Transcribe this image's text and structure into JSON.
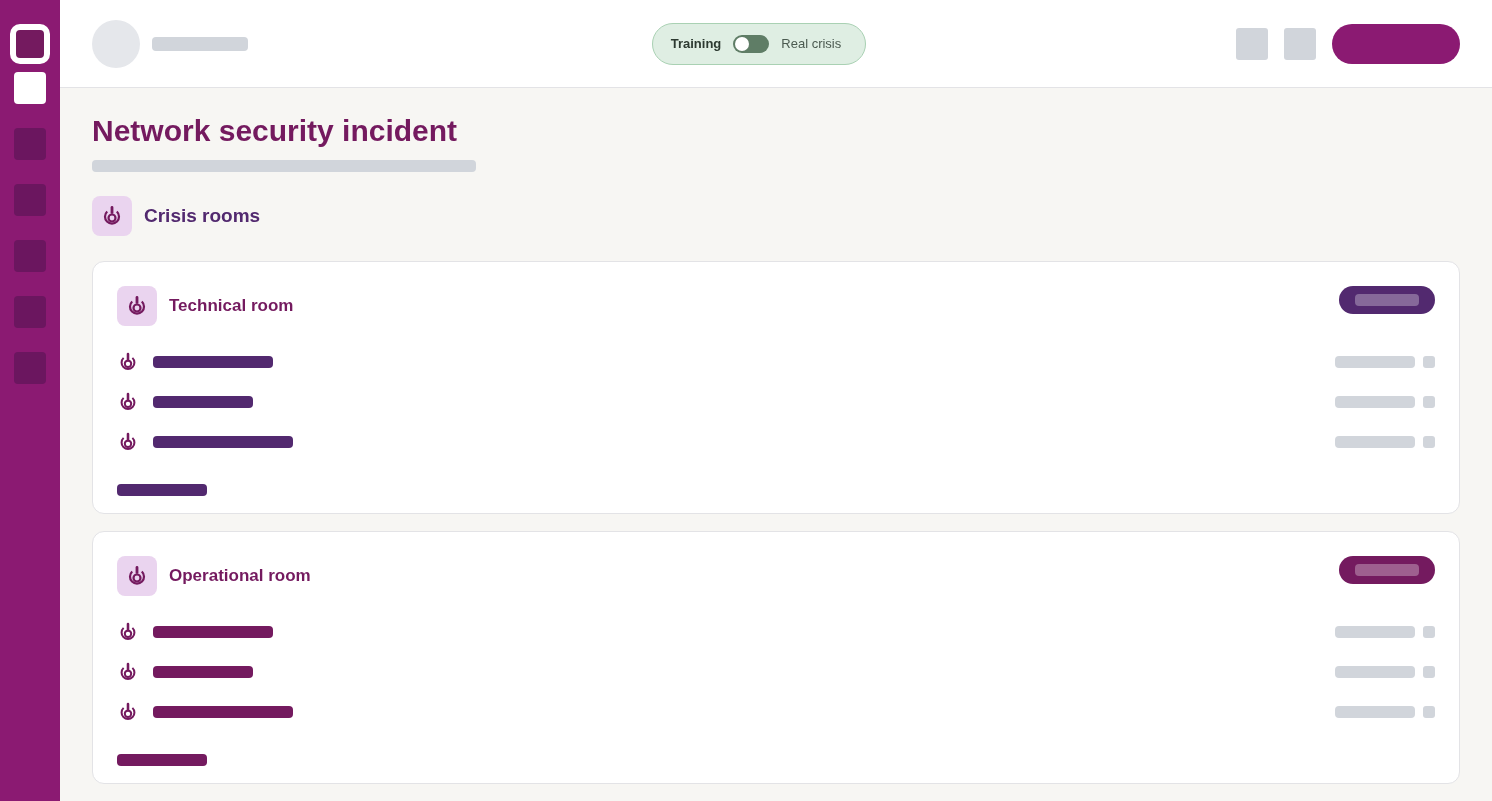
{
  "sidebar": {
    "items": [
      {
        "selected": true
      },
      {
        "selected": false
      },
      {
        "selected": false
      },
      {
        "selected": false
      },
      {
        "selected": false
      },
      {
        "selected": false
      }
    ]
  },
  "header": {
    "mode_toggle": {
      "left_label": "Training",
      "right_label": "Real crisis",
      "on": false
    }
  },
  "page": {
    "title": "Network security incident"
  },
  "section": {
    "title": "Crisis rooms"
  },
  "rooms": [
    {
      "title": "Technical room",
      "color": "#52296f"
    },
    {
      "title": "Operational room",
      "color": "#741a5f"
    }
  ]
}
